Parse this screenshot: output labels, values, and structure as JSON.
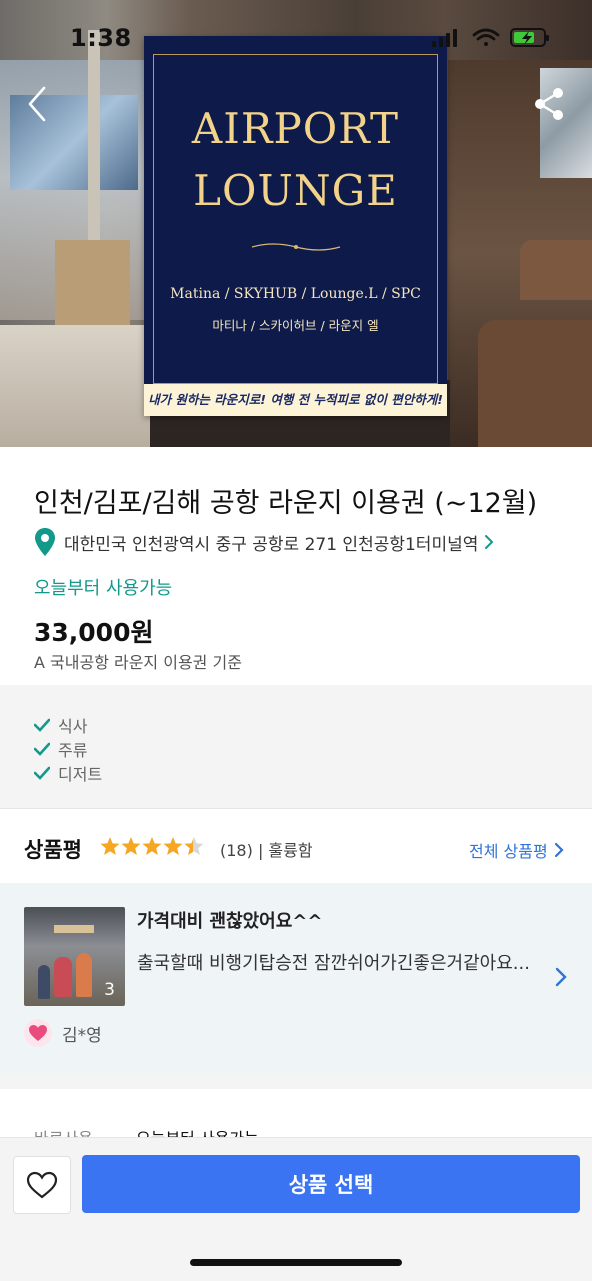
{
  "status_bar": {
    "time": "1:38"
  },
  "hero": {
    "poster_title_line1": "AIRPORT",
    "poster_title_line2": "LOUNGE",
    "poster_brands": "Matina / SKYHUB / Lounge.L / SPC",
    "poster_brands_ko": "마티나 / 스카이허브 / 라운지 엘",
    "poster_banner": "내가 원하는 라운지로! 여행 전 누적피로 없이 편안하게!",
    "back_icon": "chevron-left-icon",
    "share_icon": "share-icon"
  },
  "product": {
    "title": "인천/김포/김해 공항 라운지 이용권 (~12월)",
    "address": "대한민국 인천광역시 중구 공항로 271 인천공항1터미널역",
    "availability": "오늘부터 사용가능",
    "price": "33,000원",
    "price_note": "A 국내공항 라운지 이용권 기준",
    "accent_color": "#12998a"
  },
  "amenities": [
    "식사",
    "주류",
    "디저트"
  ],
  "reviews": {
    "heading": "상품평",
    "rating": 4.5,
    "count": "(18)",
    "summary": "| 훌륭함",
    "see_all": "전체 상품평",
    "card": {
      "photo_count": "3",
      "subject": "가격대비  괜찮았어요^^",
      "body": "출국할때  비행기탑승전 잠깐쉬어가긴좋은거같아요...",
      "user": "김*영"
    }
  },
  "details": {
    "label": "바로사용",
    "value": "오늘부터 사용가능"
  },
  "bottom_bar": {
    "select_label": "상품 선택",
    "button_color": "#3b74f2",
    "wishlist_icon": "heart-icon"
  }
}
